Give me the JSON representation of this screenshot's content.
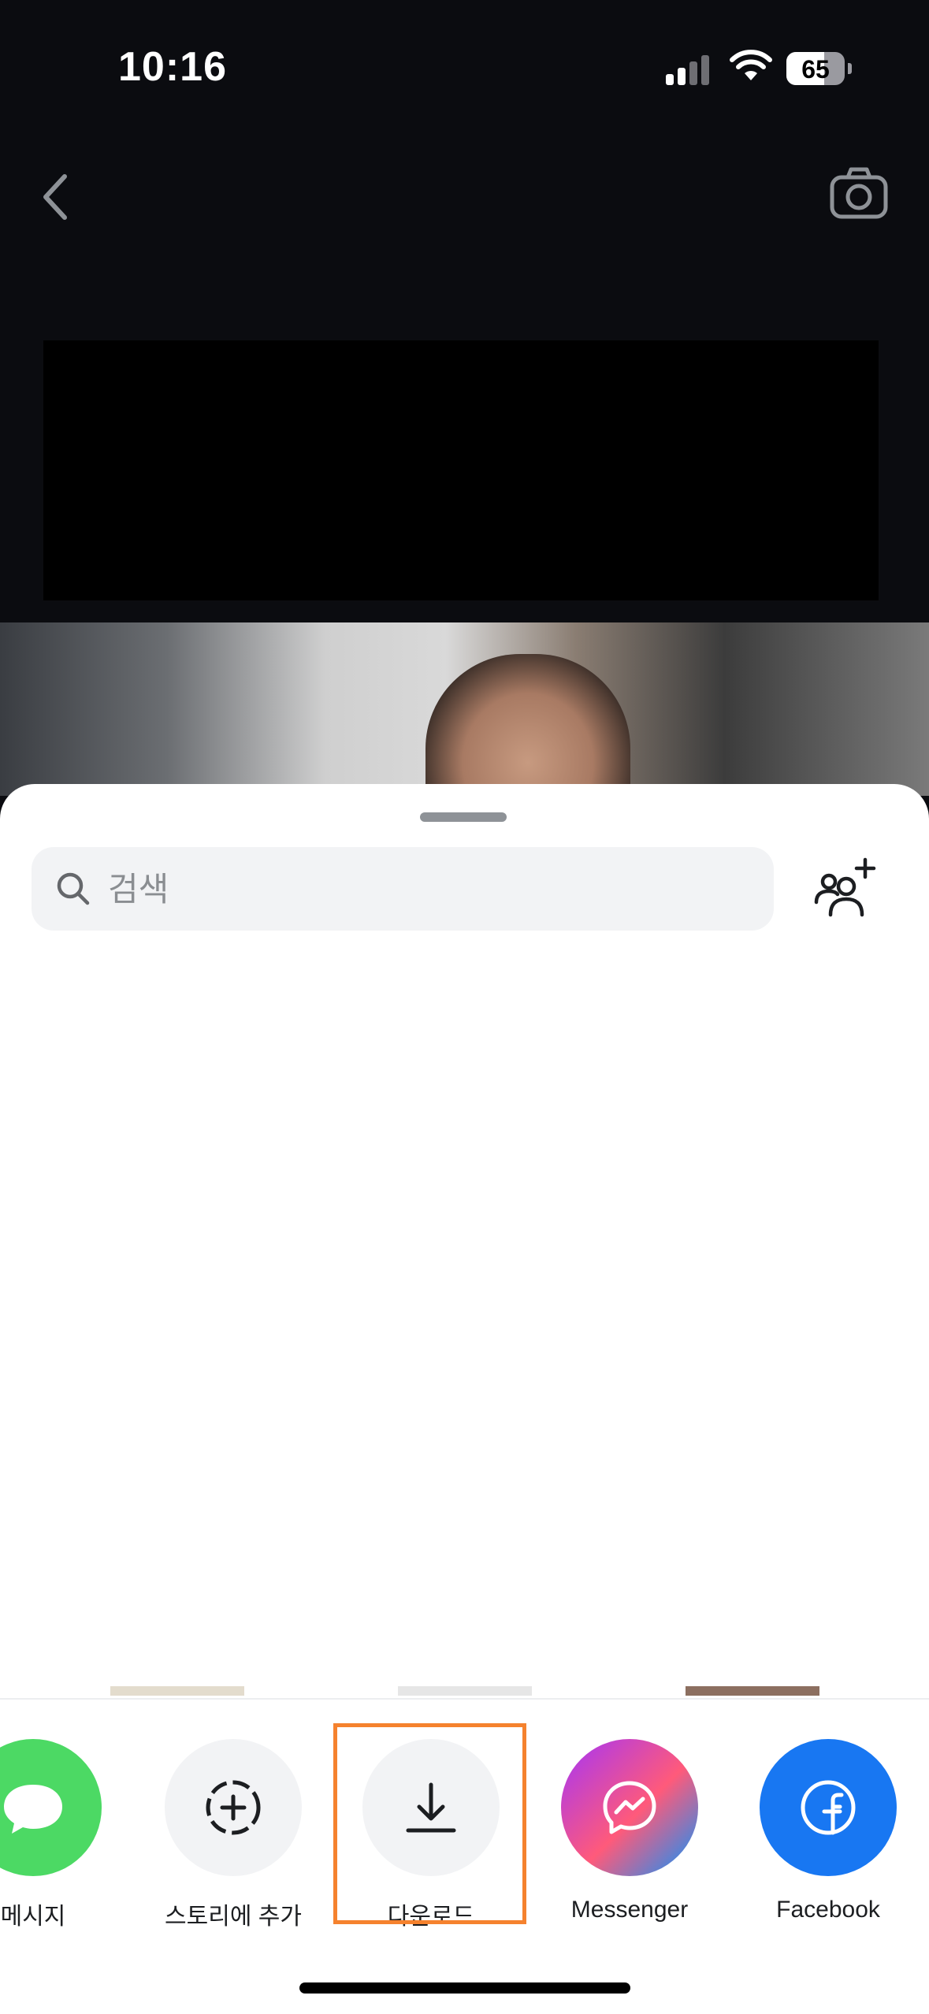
{
  "status_bar": {
    "time": "10:16",
    "battery": "65"
  },
  "nav": {
    "back_icon": "chevron-left-icon",
    "camera_icon": "camera-icon"
  },
  "search": {
    "placeholder": "검색",
    "value": ""
  },
  "share_actions": [
    {
      "label": "메시지",
      "icon": "message-bubble-icon",
      "color": "#4cd964"
    },
    {
      "label": "스토리에 추가",
      "icon": "add-story-icon",
      "color": "#f2f3f5"
    },
    {
      "label": "다운로드",
      "icon": "download-icon",
      "color": "#f2f3f5"
    },
    {
      "label": "Messenger",
      "icon": "messenger-icon",
      "color": "#a334fa"
    },
    {
      "label": "Facebook",
      "icon": "facebook-icon",
      "color": "#1877f2"
    }
  ],
  "highlight_color": "#f5822e"
}
